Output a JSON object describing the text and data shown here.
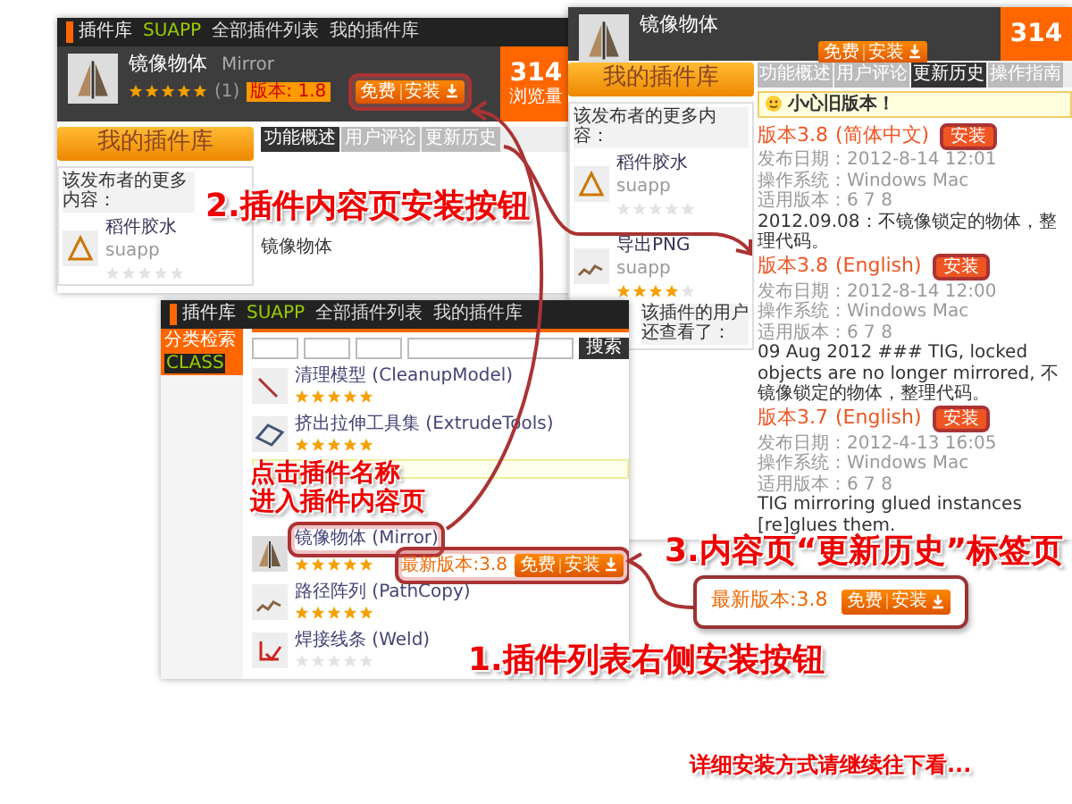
{
  "plugin_page": {
    "nav": {
      "logo": "插件库",
      "logo_sub": "SUAPP",
      "links": [
        "全部插件列表",
        "我的插件库"
      ]
    },
    "plugin": {
      "name": "镜像物体",
      "name_en": "Mirror",
      "stars": 5,
      "rating_count": "(1)",
      "version": "版本: 1.8",
      "install": {
        "free": "免费",
        "label": "安装"
      },
      "views": "314",
      "views_label": "浏览量"
    },
    "my_library_button": "我的插件库",
    "tabs": [
      {
        "label": "功能概述",
        "selected": true
      },
      {
        "label": "用户评论",
        "selected": false
      },
      {
        "label": "更新历史",
        "selected": false
      }
    ],
    "sidebar": {
      "heading": "该发布者的更多内容：",
      "items": [
        {
          "name": "稻件胶水",
          "author": "suapp",
          "stars": 0
        }
      ]
    },
    "body_title": "镜像物体"
  },
  "history_page": {
    "plugin": {
      "name": "镜像物体",
      "install": {
        "free": "免费",
        "label": "安装"
      },
      "views": "314"
    },
    "my_library_button": "我的插件库",
    "tabs": [
      {
        "label": "功能概述",
        "selected": false
      },
      {
        "label": "用户评论",
        "selected": false
      },
      {
        "label": "更新历史",
        "selected": true
      },
      {
        "label": "操作指南",
        "selected": false
      }
    ],
    "sidebar": {
      "heading": "该发布者的更多内容：",
      "items": [
        {
          "name": "稻件胶水",
          "author": "suapp",
          "stars": 0
        },
        {
          "name": "导出PNG",
          "author": "suapp",
          "stars": 4
        }
      ],
      "heading_2": "该插件的用户还查看了："
    },
    "notice": "小心旧版本！",
    "versions": [
      {
        "title": "版本3.8",
        "lang": "(简体中文)",
        "install": "安装",
        "date": "发布日期：2012-8-14 12:01",
        "os": "操作系统：Windows  Mac",
        "compat": "适用版本：6  7  8",
        "note": "2012.09.08：不镜像锁定的物体，整理代码。"
      },
      {
        "title": "版本3.8",
        "lang": "(English)",
        "install": "安装",
        "date": "发布日期：2012-8-14 12:00",
        "os": "操作系统：Windows  Mac",
        "compat": "适用版本：6  7  8",
        "note": "09 Aug 2012 ### TIG, locked objects are no longer mirrored, 不镜像锁定的物体，整理代码。"
      },
      {
        "title": "版本3.7",
        "lang": "(English)",
        "install": "安装",
        "date": "发布日期：2012-4-13 16:05",
        "os": "操作系统：Windows  Mac",
        "compat": "适用版本：6  7  8",
        "note": "TIG mirroring glued instances [re]glues them."
      }
    ]
  },
  "list_page": {
    "nav": {
      "logo": "插件库",
      "logo_sub": "SUAPP",
      "links": [
        "全部插件列表",
        "我的插件库"
      ]
    },
    "category": {
      "title": "分类检索",
      "badge": "CLASS"
    },
    "search_button": "搜索",
    "plugins": [
      {
        "title": "清理模型 (CleanupModel)",
        "stars": 5
      },
      {
        "title": "挤出拉伸工具集 (ExtrudeTools)",
        "stars": 5
      },
      {
        "title": "镜像物体 (Mirror)",
        "stars": 5,
        "latest": "最新版本:3.8",
        "install": {
          "free": "免费",
          "label": "安装"
        }
      },
      {
        "title": "路径阵列 (PathCopy)",
        "stars": 5
      },
      {
        "title": "焊接线条 (Weld)",
        "stars": 0
      }
    ]
  },
  "callout": {
    "latest": "最新版本:3.8",
    "install": {
      "free": "免费",
      "label": "安装"
    }
  },
  "annotations": {
    "step_2": "2.插件内容页安装按钮",
    "step_3": "3.内容页“更新历史”标签页",
    "click_hint": [
      "点击插件名称",
      "进入插件内容页"
    ],
    "step_1": "1.插件列表右侧安装按钮",
    "footer": "详细安装方式请继续往下看..."
  }
}
